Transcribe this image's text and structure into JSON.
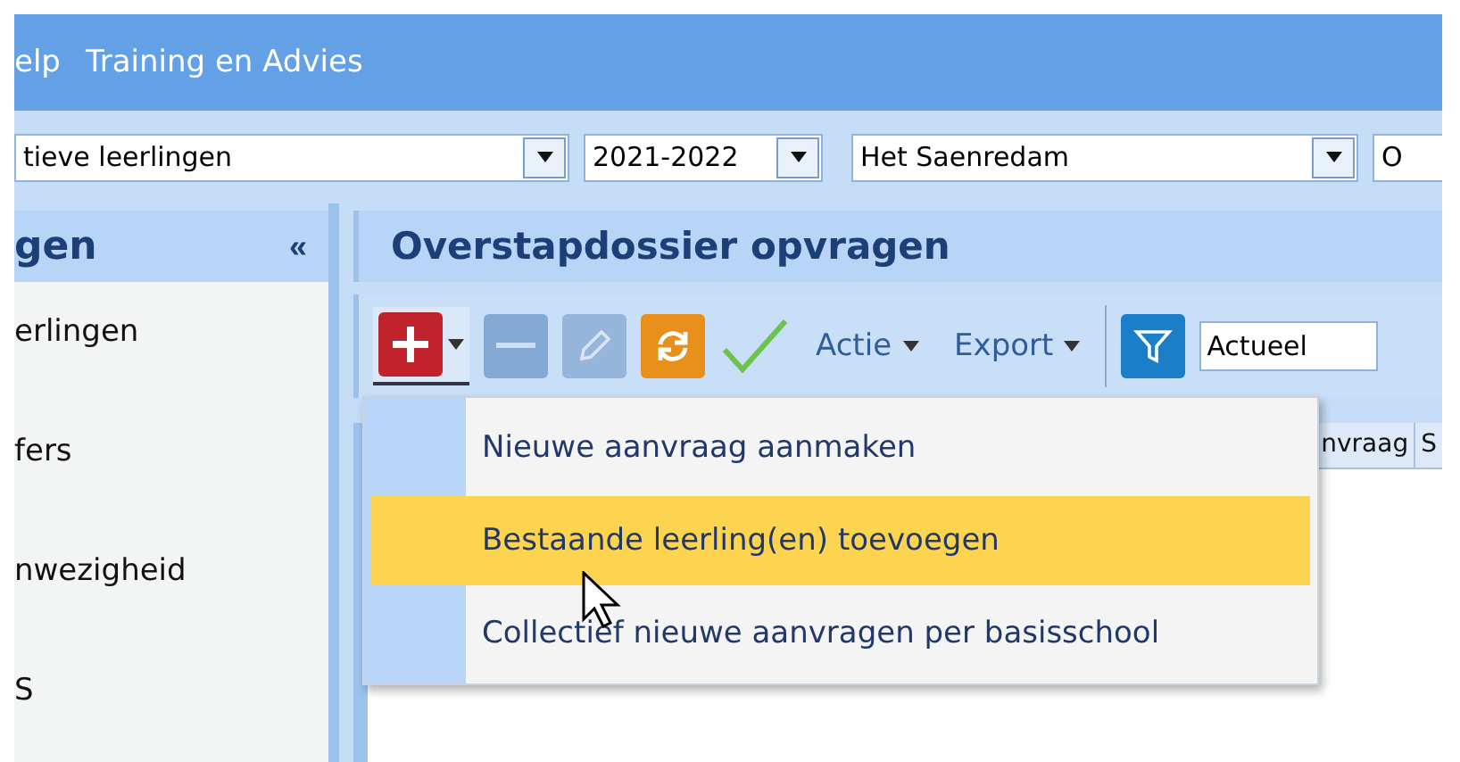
{
  "menubar": {
    "items": [
      {
        "label": "elp"
      },
      {
        "label": "Training en Advies"
      }
    ]
  },
  "filters": {
    "group": "tieve leerlingen",
    "year": "2021-2022",
    "school": "Het Saenredam",
    "extra": "O"
  },
  "sidebar": {
    "title": "gen",
    "collapse": "«",
    "items": [
      {
        "label": "erlingen"
      },
      {
        "label": "fers"
      },
      {
        "label": "nwezigheid"
      },
      {
        "label": "S"
      }
    ]
  },
  "panel": {
    "title": "Overstapdossier opvragen"
  },
  "toolbar": {
    "buttons": [
      {
        "kind": "add",
        "disabled": false,
        "expanded": true
      },
      {
        "kind": "remove",
        "disabled": true
      },
      {
        "kind": "edit",
        "disabled": true
      },
      {
        "kind": "refresh",
        "disabled": false
      }
    ],
    "actie": "Actie",
    "export": "Export",
    "filter_value": "Actueel"
  },
  "table": {
    "columns": [
      "nvraag",
      "S"
    ]
  },
  "dropdown_menu": {
    "items": [
      {
        "label": "Nieuwe aanvraag aanmaken",
        "selected": false
      },
      {
        "label": "Bestaande leerling(en) toevoegen",
        "selected": true
      },
      {
        "label": "Collectief nieuwe aanvragen per basisschool",
        "selected": false
      }
    ]
  }
}
